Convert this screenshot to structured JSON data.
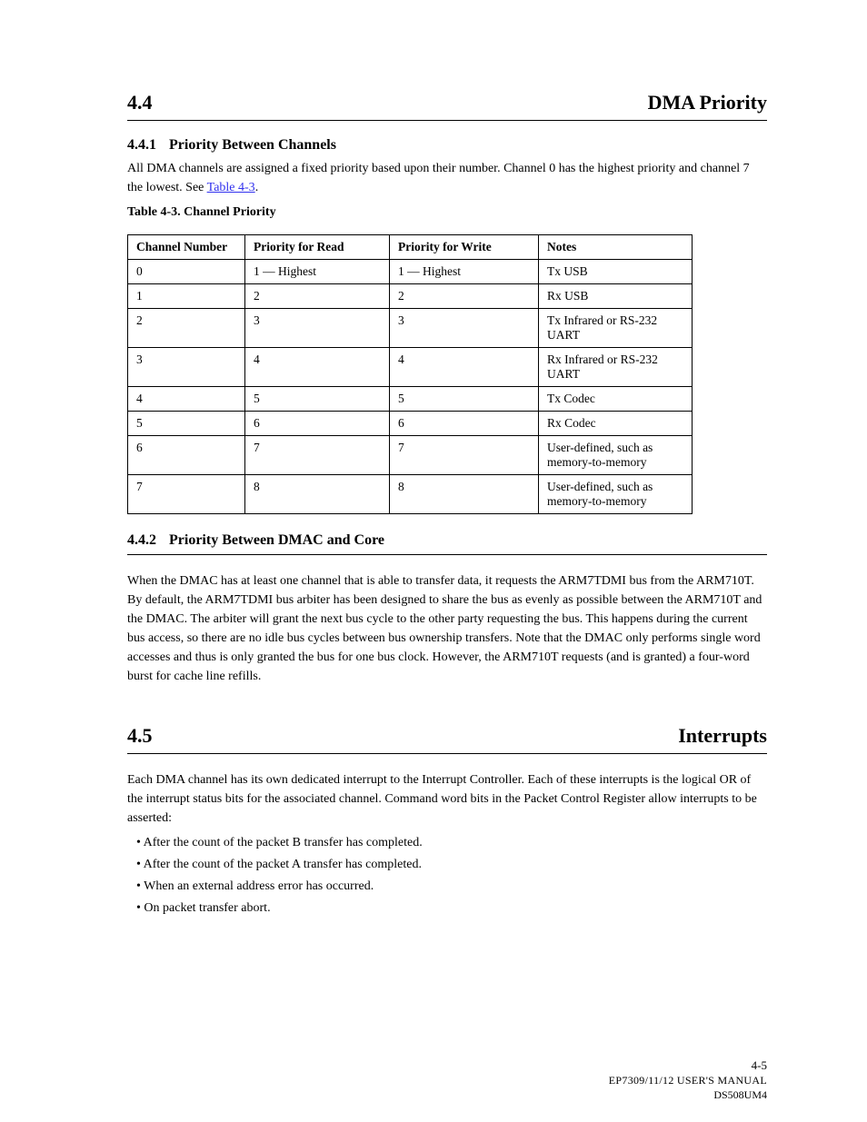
{
  "section_4_4": {
    "num": "4.4",
    "title": "DMA Priority",
    "sub_num": "4.4.1",
    "sub_title": "Priority Between Channels",
    "para1": "All DMA channels are assigned a fixed priority based upon their number. Channel 0 has the highest priority and channel 7 the lowest. See ",
    "link_text": "Table 4-3",
    "para1_after": "."
  },
  "table_4_3": {
    "caption": "Table 4-3. Channel Priority",
    "headers": [
      "Channel Number",
      "Priority for Read",
      "Priority for Write",
      "Notes"
    ],
    "rows": [
      [
        "0",
        "1 — Highest",
        "1 — Highest",
        "Tx USB"
      ],
      [
        "1",
        "2",
        "2",
        "Rx USB"
      ],
      [
        "2",
        "3",
        "3",
        "Tx Infrared or RS-232 UART"
      ],
      [
        "3",
        "4",
        "4",
        "Rx Infrared or RS-232 UART"
      ],
      [
        "4",
        "5",
        "5",
        "Tx Codec"
      ],
      [
        "5",
        "6",
        "6",
        "Rx Codec"
      ],
      [
        "6",
        "7",
        "7",
        "User-defined, such as memory-to-memory"
      ],
      [
        "7",
        "8",
        "8",
        "User-defined, such as memory-to-memory"
      ]
    ]
  },
  "section_4_4_2": {
    "num": "4.4.2",
    "title": "Priority Between DMAC and Core",
    "para": "When the DMAC has at least one channel that is able to transfer data, it requests the ARM7TDMI bus from the ARM710T. By default, the ARM7TDMI bus arbiter has been designed to share the bus as evenly as possible between the ARM710T and the DMAC. The arbiter will grant the next bus cycle to the other party requesting the bus. This happens during the current bus access, so there are no idle bus cycles between bus ownership transfers. Note that the DMAC only performs single word accesses and thus is only granted the bus for one bus clock. However, the ARM710T requests (and is granted) a four-word burst for cache line refills."
  },
  "section_4_5": {
    "num": "4.5",
    "title": "Interrupts",
    "para": "Each DMA channel has its own dedicated interrupt to the Interrupt Controller. Each of these interrupts is the logical OR of the interrupt status bits for the associated channel. Command word bits in the Packet Control Register allow interrupts to be asserted:",
    "items": [
      "After the count of the packet B transfer has completed.",
      "After the count of the packet A transfer has completed.",
      "When an external address error has occurred.",
      "On packet transfer abort."
    ]
  },
  "footer": {
    "page": "4-5",
    "docid": "EP7309/11/12 USER'S MANUAL",
    "pub": "DS508UM4"
  }
}
